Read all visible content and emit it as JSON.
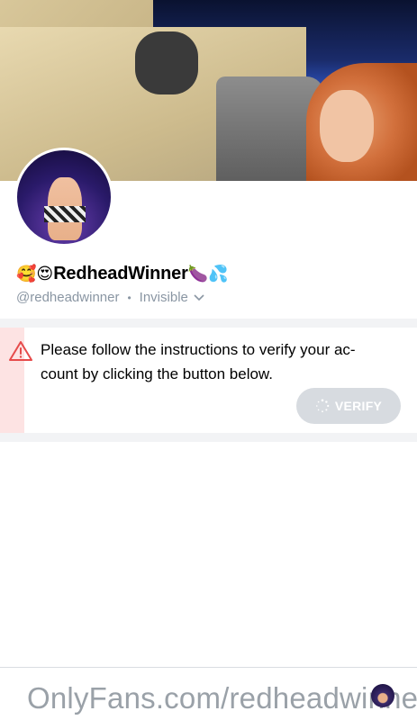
{
  "profile": {
    "name_prefix_emoji": "🥰😍",
    "name": "RedheadWinner",
    "name_suffix_emoji": "🍆💦",
    "handle": "@redheadwinner",
    "separator": "•",
    "status": "Invisible"
  },
  "notice": {
    "message": "Please follow the instructions to verify your ac-count by clicking the button below.",
    "button_label": "VERIFY"
  },
  "watermark": {
    "text": "OnlyFans.com/redheadwinner"
  },
  "icons": {
    "warning": "warning-icon",
    "chevron": "chevron-down-icon",
    "spinner": "spinner-icon"
  },
  "colors": {
    "muted_text": "#8a96a3",
    "warning_red": "#e64b4b",
    "verify_disabled": "#d7dbe0"
  }
}
